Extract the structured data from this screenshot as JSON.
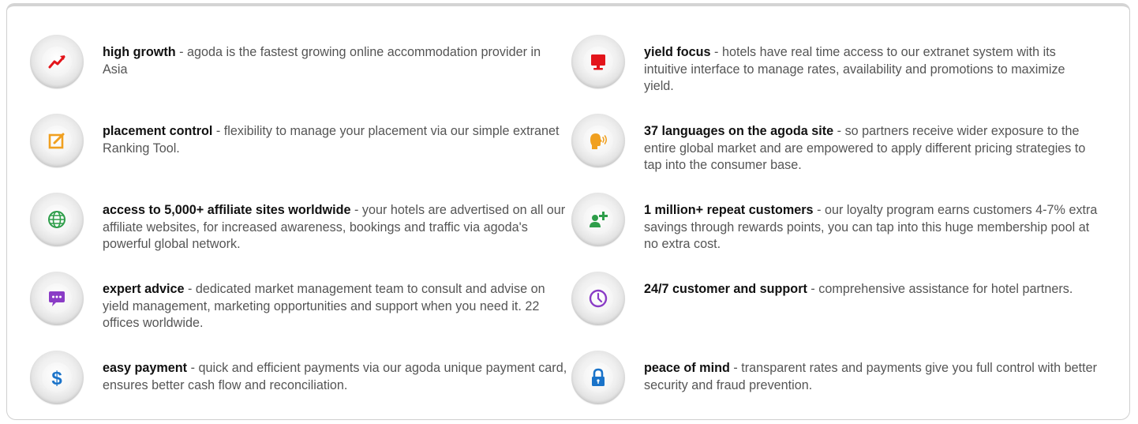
{
  "features_left": [
    {
      "title": "high growth",
      "description": " - agoda is the fastest growing online accommodation provider in Asia",
      "icon": "growth-chart-icon",
      "color": "#e3151b"
    },
    {
      "title": "placement control",
      "description": " - flexibility to manage your placement via our simple extranet Ranking Tool.",
      "icon": "edit-icon",
      "color": "#f0a020"
    },
    {
      "title": "access to 5,000+ affiliate sites worldwide",
      "description": " - your hotels are advertised on all our affiliate websites, for increased awareness, bookings and traffic via agoda's powerful global network.",
      "icon": "globe-icon",
      "color": "#2e9e4a"
    },
    {
      "title": "expert advice",
      "description": " - dedicated market management team to consult and advise on yield management, marketing opportunities and support when you need it. 22 offices worldwide.",
      "icon": "chat-bubble-icon",
      "color": "#8a3cc6"
    },
    {
      "title": "easy payment",
      "description": " - quick and efficient payments via our agoda unique payment card, ensures better cash flow and reconciliation.",
      "icon": "dollar-icon",
      "color": "#1a73c9"
    }
  ],
  "features_right": [
    {
      "title": "yield focus",
      "description": " - hotels have real time access to our extranet system with its intuitive interface to manage rates, availability and promotions to maximize yield.",
      "icon": "monitor-icon",
      "color": "#e3151b"
    },
    {
      "title": "37 languages on the agoda site",
      "description": " - so partners receive wider exposure to the entire global market and are empowered to apply different pricing strategies to tap into the consumer base.",
      "icon": "speaking-head-icon",
      "color": "#f0a020"
    },
    {
      "title": "1 million+ repeat customers",
      "description": " - our loyalty program earns customers 4-7% extra savings through rewards points, you can tap into this huge membership pool at no extra cost.",
      "icon": "add-user-icon",
      "color": "#2e9e4a"
    },
    {
      "title": "24/7 customer and support",
      "description": " - comprehensive assistance for hotel partners.",
      "icon": "clock-icon",
      "color": "#8a3cc6"
    },
    {
      "title": "peace of mind",
      "description": " - transparent rates and payments give you full control with better security and fraud prevention.",
      "icon": "lock-icon",
      "color": "#1a73c9"
    }
  ]
}
